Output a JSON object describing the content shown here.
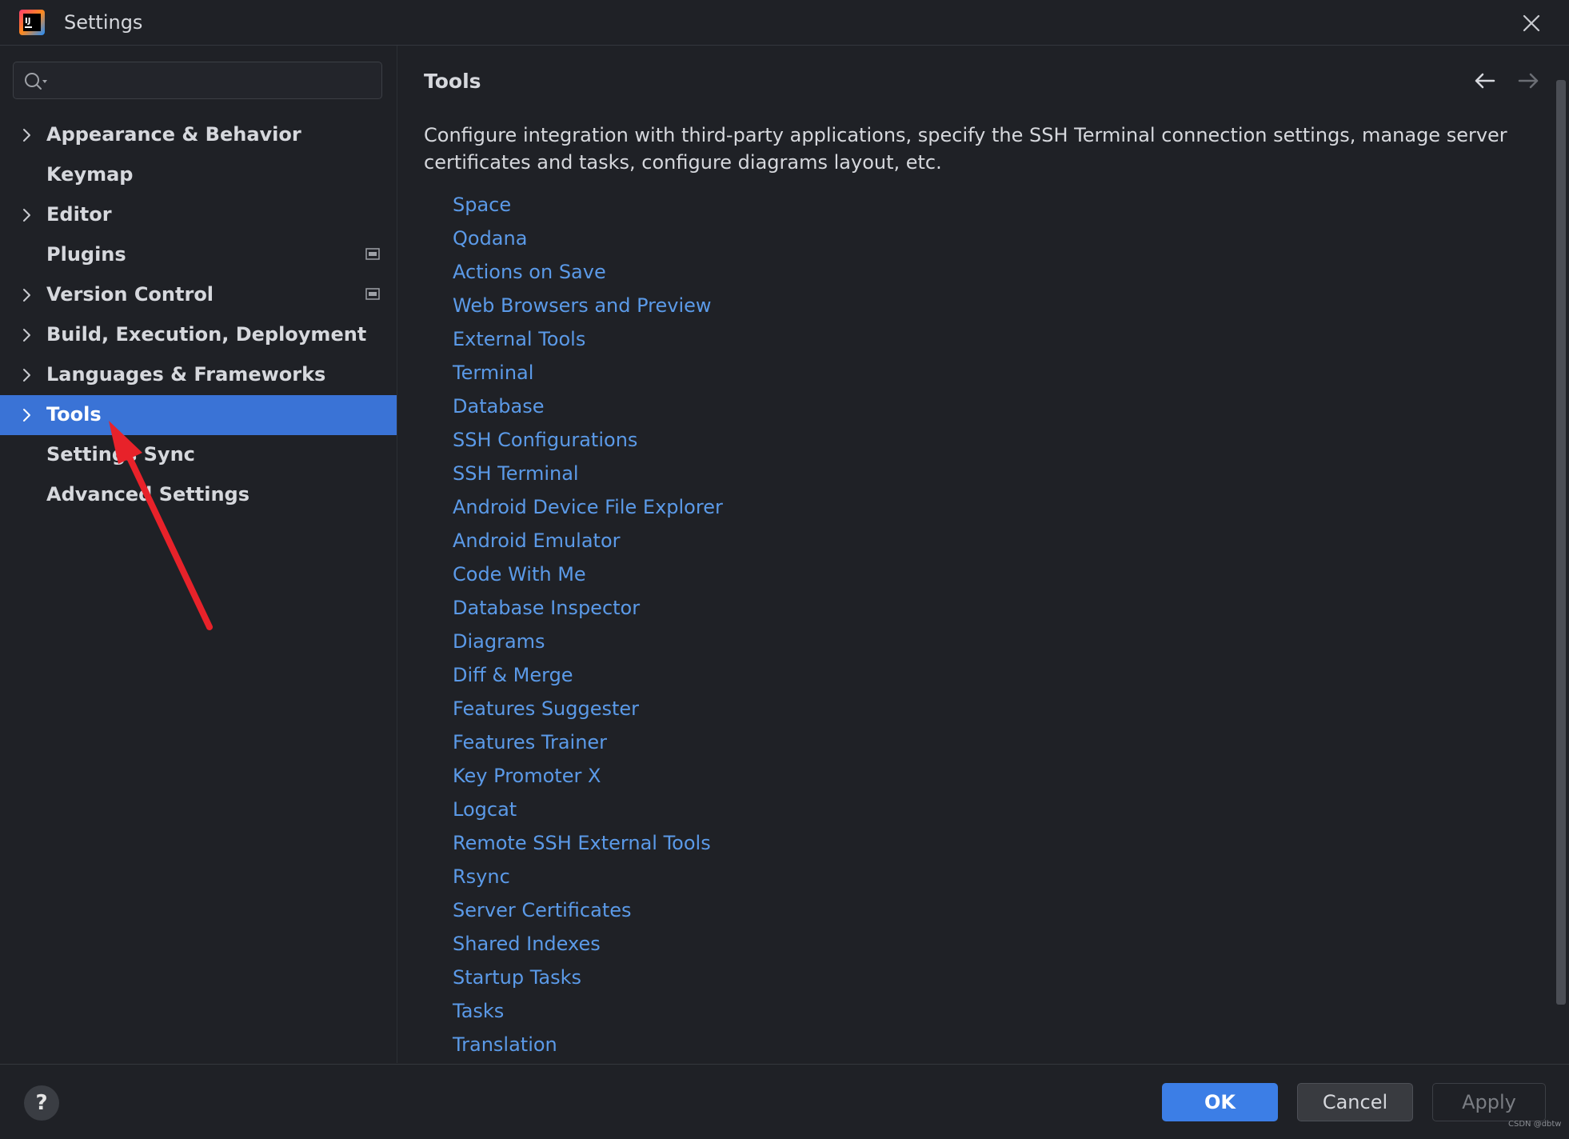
{
  "window": {
    "title": "Settings",
    "app_icon": "intellij-logo-icon",
    "close_icon": "close-icon"
  },
  "search": {
    "value": "",
    "placeholder": "",
    "icon": "search-icon"
  },
  "sidebar": {
    "items": [
      {
        "label": "Appearance & Behavior",
        "expandable": true,
        "selected": false
      },
      {
        "label": "Keymap",
        "expandable": false,
        "selected": false
      },
      {
        "label": "Editor",
        "expandable": true,
        "selected": false
      },
      {
        "label": "Plugins",
        "expandable": false,
        "selected": false,
        "project_icon": true
      },
      {
        "label": "Version Control",
        "expandable": true,
        "selected": false,
        "project_icon": true
      },
      {
        "label": "Build, Execution, Deployment",
        "expandable": true,
        "selected": false
      },
      {
        "label": "Languages & Frameworks",
        "expandable": true,
        "selected": false
      },
      {
        "label": "Tools",
        "expandable": true,
        "selected": true
      },
      {
        "label": "Settings Sync",
        "expandable": false,
        "selected": false
      },
      {
        "label": "Advanced Settings",
        "expandable": false,
        "selected": false
      }
    ],
    "selected_color": "#3a73d6"
  },
  "main": {
    "title": "Tools",
    "description": "Configure integration with third-party applications, specify the SSH Terminal connection settings, manage server certificates and tasks, configure diagrams layout, etc.",
    "links": [
      "Space",
      "Qodana",
      "Actions on Save",
      "Web Browsers and Preview",
      "External Tools",
      "Terminal",
      "Database",
      "SSH Configurations",
      "SSH Terminal",
      "Android Device File Explorer",
      "Android Emulator",
      "Code With Me",
      "Database Inspector",
      "Diagrams",
      "Diff & Merge",
      "Features Suggester",
      "Features Trainer",
      "Key Promoter X",
      "Logcat",
      "Remote SSH External Tools",
      "Rsync",
      "Server Certificates",
      "Shared Indexes",
      "Startup Tasks",
      "Tasks",
      "Translation"
    ],
    "link_color": "#5b9ae8",
    "back_icon": "arrow-left-icon",
    "forward_icon": "arrow-right-icon"
  },
  "footer": {
    "help_label": "?",
    "ok_label": "OK",
    "cancel_label": "Cancel",
    "apply_label": "Apply",
    "ok_color": "#3c7ee6"
  },
  "annotation": {
    "arrow_color": "#e8222a"
  },
  "watermark": "CSDN @dbtw"
}
